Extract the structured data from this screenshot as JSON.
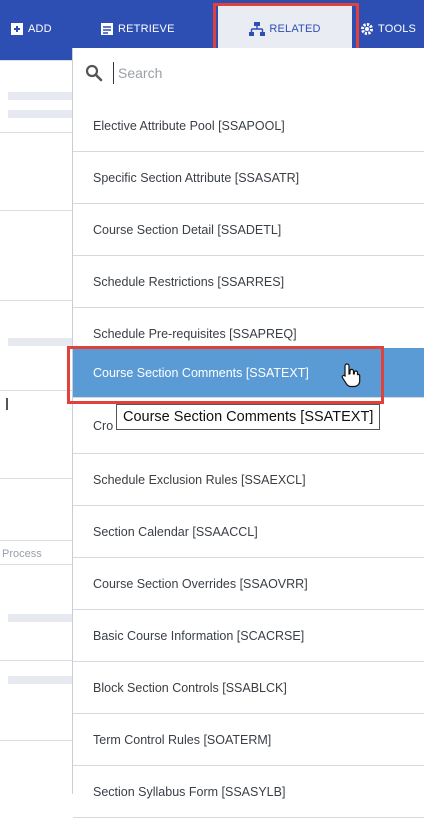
{
  "toolbar": {
    "items": [
      {
        "label": "ADD",
        "icon": "add-document-icon"
      },
      {
        "label": "RETRIEVE",
        "icon": "retrieve-document-icon"
      },
      {
        "label": "RELATED",
        "icon": "related-hierarchy-icon",
        "active": true
      },
      {
        "label": "TOOLS",
        "icon": "gear-icon"
      }
    ],
    "accent_color": "#2d4fb4",
    "highlight_color": "#e0413a"
  },
  "left_panel": {
    "partial_text": "Process"
  },
  "search": {
    "placeholder": "Search",
    "value": ""
  },
  "menu": {
    "items": [
      {
        "label": "Elective Attribute Pool [SSAPOOL]"
      },
      {
        "label": "Specific Section Attribute [SSASATR]"
      },
      {
        "label": "Course Section Detail [SSADETL]"
      },
      {
        "label": "Schedule Restrictions [SSARRES]"
      },
      {
        "label": "Schedule Pre-requisites [SSAPREQ]"
      },
      {
        "label": "Course Section Comments [SSATEXT]",
        "selected": true
      },
      {
        "label": "Cro"
      },
      {
        "label": "Schedule Exclusion Rules [SSAEXCL]"
      },
      {
        "label": "Section Calendar [SSAACCL]"
      },
      {
        "label": "Course Section Overrides [SSAOVRR]"
      },
      {
        "label": "Basic Course Information [SCACRSE]"
      },
      {
        "label": "Block Section Controls [SSABLCK]"
      },
      {
        "label": "Term Control Rules [SOATERM]"
      },
      {
        "label": "Section Syllabus Form [SSASYLB]"
      }
    ],
    "selected_color": "#5b9bd5"
  },
  "tooltip": {
    "text": "Course Section Comments [SSATEXT]"
  }
}
